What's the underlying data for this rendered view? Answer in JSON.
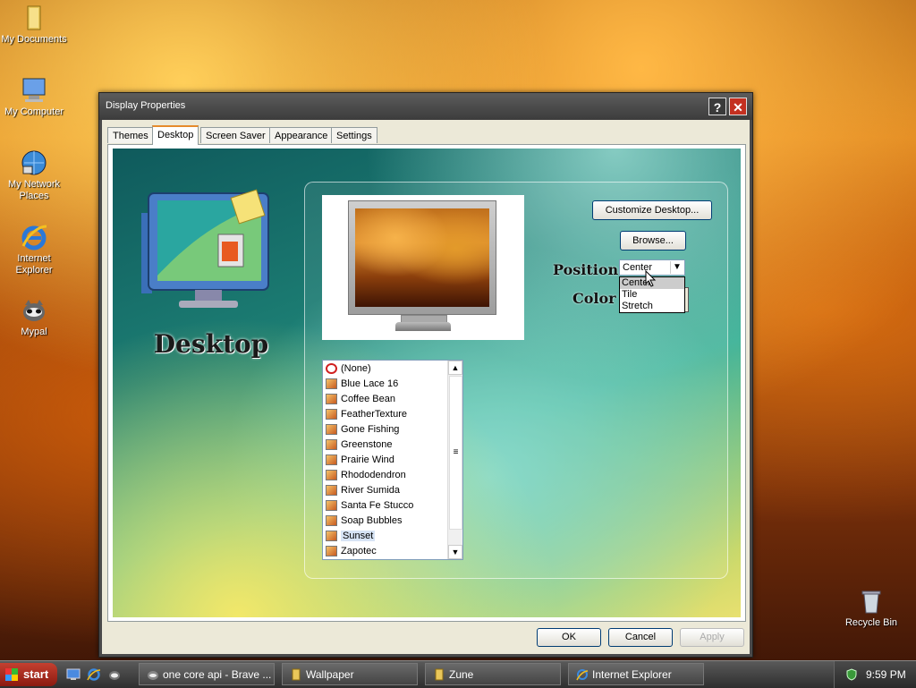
{
  "desktop_icons": [
    {
      "label": "My Documents",
      "icon": "folder-icon"
    },
    {
      "label": "My Computer",
      "icon": "computer-icon"
    },
    {
      "label": "My Network Places",
      "icon": "network-icon"
    },
    {
      "label": "Internet Explorer",
      "icon": "ie-icon"
    },
    {
      "label": "Mypal",
      "icon": "mypal-icon"
    },
    {
      "label": "Recycle Bin",
      "icon": "recycle-bin-icon"
    }
  ],
  "window": {
    "title": "Display Properties",
    "help_label": "?",
    "close_label": "✕",
    "tabs": [
      {
        "label": "Themes",
        "active": false
      },
      {
        "label": "Desktop",
        "active": true
      },
      {
        "label": "Screen Saver",
        "active": false
      },
      {
        "label": "Appearance",
        "active": false
      },
      {
        "label": "Settings",
        "active": false
      }
    ],
    "panel_caption": "Desktop",
    "customize_label": "Customize Desktop...",
    "browse_label": "Browse...",
    "position_label": "Position :",
    "color_label": "Color :",
    "position": {
      "selected": "Center",
      "options": [
        "Center",
        "Tile",
        "Stretch"
      ],
      "expanded": true
    },
    "wallpapers": [
      {
        "label": "(None)"
      },
      {
        "label": "Blue Lace 16"
      },
      {
        "label": "Coffee Bean"
      },
      {
        "label": "FeatherTexture"
      },
      {
        "label": "Gone Fishing"
      },
      {
        "label": "Greenstone"
      },
      {
        "label": "Prairie Wind"
      },
      {
        "label": "Rhododendron"
      },
      {
        "label": "River Sumida"
      },
      {
        "label": "Santa Fe Stucco"
      },
      {
        "label": "Soap Bubbles"
      },
      {
        "label": "Sunset"
      },
      {
        "label": "Zapotec"
      }
    ],
    "selected_wallpaper": "Sunset",
    "ok_label": "OK",
    "cancel_label": "Cancel",
    "apply_label": "Apply"
  },
  "taskbar": {
    "start_label": "start",
    "tasks": [
      {
        "label": "one core api - Brave ...",
        "icon": "brave-icon"
      },
      {
        "label": "Wallpaper",
        "icon": "folder-icon"
      },
      {
        "label": "Zune",
        "icon": "folder-icon"
      },
      {
        "label": "Internet Explorer",
        "icon": "ie-icon"
      }
    ],
    "clock": "9:59 PM"
  },
  "colors": {
    "accent_tab": "#e68b2c",
    "close_button": "#c43020",
    "taskbar": "#3a3a3a"
  }
}
